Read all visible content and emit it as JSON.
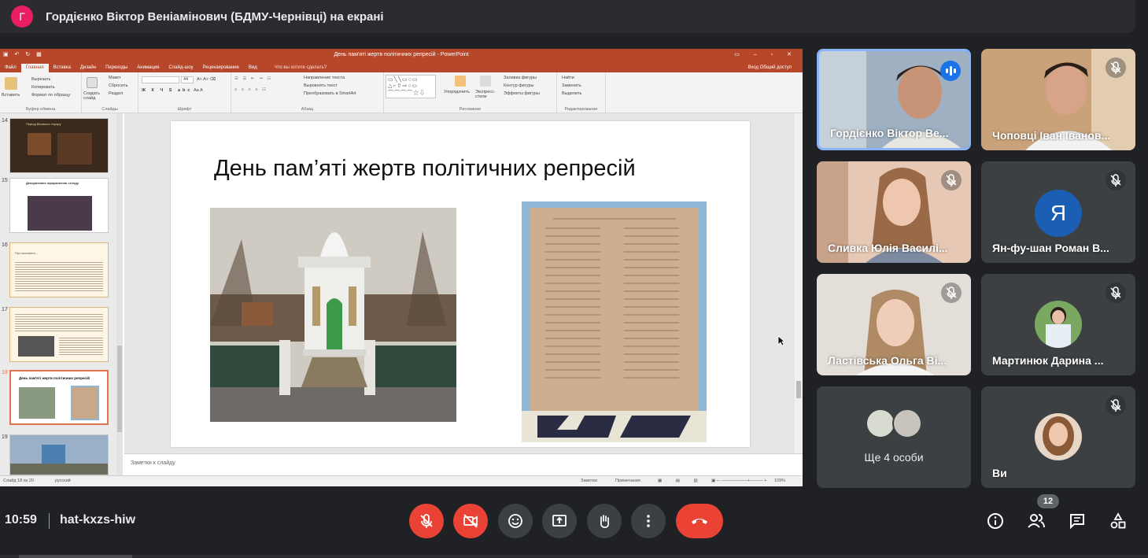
{
  "banner": {
    "avatar_letter": "Г",
    "text": "Гордієнко Віктор Веніамінович (БДМУ-Чернівці) на екрані"
  },
  "ppt": {
    "window_title": "День пам'яті жертв політичних репресій - PowerPoint",
    "tabs": [
      "Файл",
      "Главная",
      "Вставка",
      "Дизайн",
      "Переходы",
      "Анимация",
      "Слайд-шоу",
      "Рецензирование",
      "Вид"
    ],
    "active_tab": "Главная",
    "tell_me": "Что вы хотите сделать?",
    "right_tabs": "Вход  Общий доступ",
    "ribbon": {
      "clipboard": {
        "paste": "Вставить",
        "cut": "Вырезать",
        "copy": "Копировать",
        "format": "Формат по образцу",
        "group": "Буфер обмена"
      },
      "slides": {
        "create": "Создать слайд",
        "layout": "Макет",
        "reset": "Сбросить",
        "section": "Раздел",
        "group": "Слайды"
      },
      "font": {
        "size": "44",
        "group": "Шрифт"
      },
      "paragraph": {
        "dir": "Направление текста",
        "align": "Выровнять текст",
        "smartart": "Преобразовать в SmartArt",
        "group": "Абзац"
      },
      "drawing": {
        "arrange": "Упорядочить",
        "quick": "Экспресс-стили",
        "fill": "Заливка фигуры",
        "outline": "Контур фигуры",
        "effects": "Эффекты фигуры",
        "group": "Рисование"
      },
      "editing": {
        "find": "Найти",
        "replace": "Заменить",
        "select": "Выделить",
        "group": "Редактирование"
      }
    },
    "thumbnails": [
      {
        "num": "14",
        "caption": "Період Великого терору"
      },
      {
        "num": "15",
        "caption": "Декоративне оформлення стенду"
      },
      {
        "num": "16",
        "caption": "Про визнання...",
        "thin": true
      },
      {
        "num": "17",
        "caption": ""
      },
      {
        "num": "18",
        "caption": "День пам'яті жертв політичних репресій",
        "selected": true
      },
      {
        "num": "19",
        "caption": ""
      }
    ],
    "slide_title": "День пам’яті жертв політичних репресій",
    "notes_placeholder": "Заметки к слайду",
    "status": {
      "slide": "Слайд 18 из 20",
      "lang": "русский",
      "notes": "Заметки",
      "comments": "Примечания",
      "zoom": "109%"
    }
  },
  "participants": [
    {
      "name": "Гордієнко Віктор Ве...",
      "speaking": true
    },
    {
      "name": "Чоповці Іван Іванов...",
      "muted": true
    },
    {
      "name": "Сливка Юлія Василі...",
      "muted": true
    },
    {
      "name": "Ян-фу-шан Роман В...",
      "muted": true,
      "letter": "Я"
    },
    {
      "name": "Ластівська Ольга Ві...",
      "muted": true
    },
    {
      "name": "Мартинюк Дарина ...",
      "muted": true
    },
    {
      "name": "Ще 4 особи"
    },
    {
      "name": "Ви",
      "muted": true
    }
  ],
  "bottom": {
    "time": "10:59",
    "code": "hat-kxzs-hiw",
    "people_count": "12"
  },
  "colors": {
    "meet_bg": "#202124",
    "accent_blue": "#8ab4f8",
    "red": "#ea4335",
    "ppt_orange": "#b7472a"
  }
}
